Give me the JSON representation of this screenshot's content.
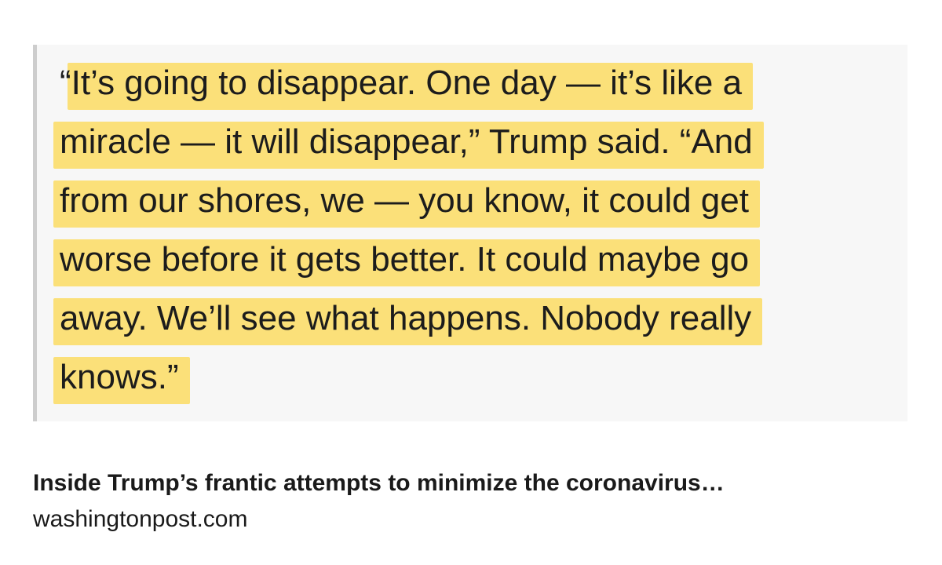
{
  "quote": {
    "lines": [
      "“It’s going to disappear. One day — it’s like a",
      "miracle — it will disappear,” Trump said. “And",
      "from our shores, we — you know, it could get",
      "worse before it gets better. It could maybe go",
      "away. We’ll see what happens. Nobody really",
      "knows.”"
    ],
    "highlight_color": "#fbdd6e",
    "bar_color": "#cdcdcd",
    "card_background": "#f7f7f7"
  },
  "link": {
    "title": "Inside Trump’s frantic attempts to minimize the coronavirus…",
    "domain": "washingtonpost.com"
  }
}
